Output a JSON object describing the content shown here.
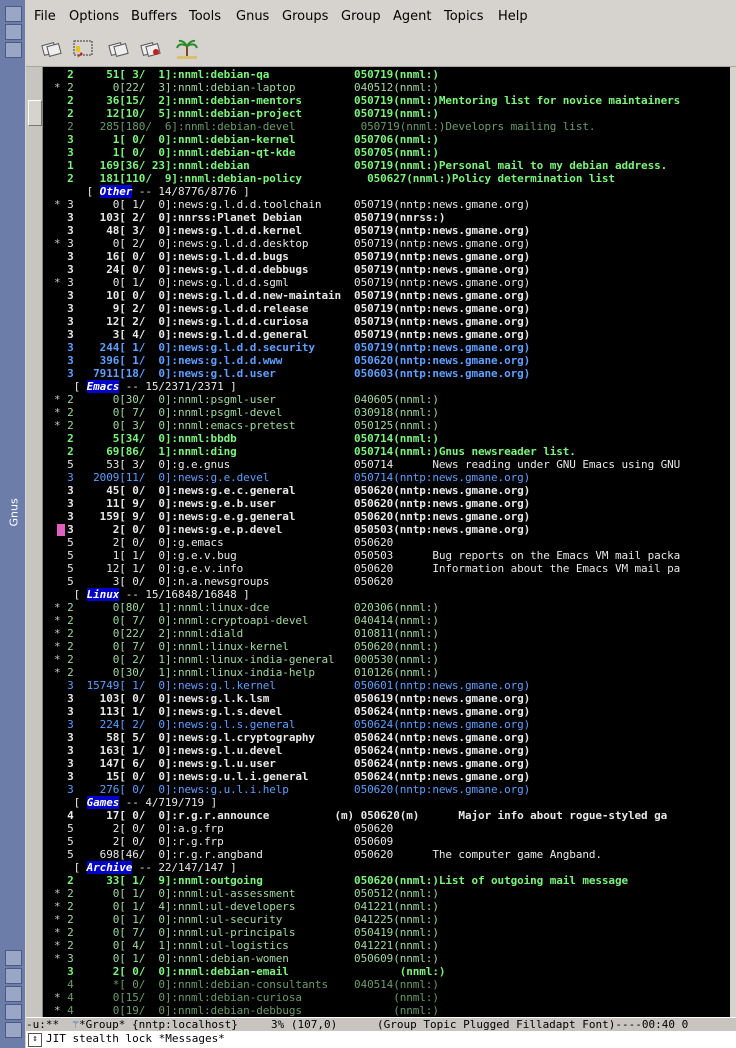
{
  "menu": [
    "File",
    "Options",
    "Buffers",
    "Tools",
    "Gnus",
    "Groups",
    "Group",
    "Agent",
    "Topics",
    "Help"
  ],
  "frame_label": "Gnus",
  "toolbar_icons": [
    "catchup-icon",
    "get-new-news-icon",
    "subscribe-icon",
    "unsubscribe-icon",
    "exit-gnus-icon"
  ],
  "colors": {
    "bg": "#000000",
    "dim": "#a0d8a0",
    "bright": "#90ee90",
    "cyan": "#7fb2ff",
    "white": "#e8e8e8",
    "topic_bg": "#0000c8"
  },
  "lines": [
    {
      "m": " ",
      "t": "2     51[ 3/  1]:nnml:debian-qa             050719(nnml:)",
      "c": "bright",
      "b": true
    },
    {
      "m": "*",
      "t": "2      0[22/  3]:nnml:debian-laptop         040512(nnml:)",
      "c": "dim"
    },
    {
      "m": " ",
      "t": "2     36[15/  2]:nnml:debian-mentors        050719(nnml:)Mentoring list for novice maintainers",
      "c": "bright",
      "b": true
    },
    {
      "m": " ",
      "t": "2     12[10/  5]:nnml:debian-project        050719(nnml:)",
      "c": "bright",
      "b": true
    },
    {
      "m": " ",
      "t": "2    285[180/  6]:nnml:debian-devel          050719(nnml:)Developrs mailing list.",
      "c": "dim2"
    },
    {
      "m": " ",
      "t": "3      1[ 0/  0]:nnml:debian-kernel         050706(nnml:)",
      "c": "bright",
      "b": true
    },
    {
      "m": " ",
      "t": "3      1[ 0/  0]:nnml:debian-qt-kde         050705(nnml:)",
      "c": "bright",
      "b": true
    },
    {
      "m": " ",
      "t": "1    169[36/ 23]:nnml:debian                050719(nnml:)Personal mail to my debian address.",
      "c": "bright",
      "b": true
    },
    {
      "m": " ",
      "t": "2    181[110/  9]:nnml:debian-policy          050627(nnml:)Policy determination list",
      "c": "bright",
      "b": true
    },
    {
      "m": " ",
      "topic": "Other",
      "t": " -- 14/8776/8776 ]",
      "c": "white",
      "indent": "    [ "
    },
    {
      "m": "*",
      "t": "3      0[ 1/  0]:news:g.l.d.d.toolchain     050719(nntp:news.gmane.org)",
      "c": "white"
    },
    {
      "m": " ",
      "t": "3    103[ 2/  0]:nnrss:Planet Debian        050719(nnrss:)",
      "c": "white",
      "b": true
    },
    {
      "m": " ",
      "t": "3     48[ 3/  0]:news:g.l.d.d.kernel        050719(nntp:news.gmane.org)",
      "c": "white",
      "b": true
    },
    {
      "m": "*",
      "t": "3      0[ 2/  0]:news:g.l.d.d.desktop       050719(nntp:news.gmane.org)",
      "c": "white"
    },
    {
      "m": " ",
      "t": "3     16[ 0/  0]:news:g.l.d.d.bugs          050719(nntp:news.gmane.org)",
      "c": "white",
      "b": true
    },
    {
      "m": " ",
      "t": "3     24[ 0/  0]:news:g.l.d.d.debbugs       050719(nntp:news.gmane.org)",
      "c": "white",
      "b": true
    },
    {
      "m": "*",
      "t": "3      0[ 1/  0]:news:g.l.d.d.sgml          050719(nntp:news.gmane.org)",
      "c": "white"
    },
    {
      "m": " ",
      "t": "3     10[ 0/  0]:news:g.l.d.d.new-maintain  050719(nntp:news.gmane.org)",
      "c": "white",
      "b": true
    },
    {
      "m": " ",
      "t": "3      9[ 2/  0]:news:g.l.d.d.release       050719(nntp:news.gmane.org)",
      "c": "white",
      "b": true
    },
    {
      "m": " ",
      "t": "3     12[ 2/  0]:news:g.l.d.d.curiosa       050719(nntp:news.gmane.org)",
      "c": "white",
      "b": true
    },
    {
      "m": " ",
      "t": "3      3[ 4/  0]:news:g.l.d.d.general       050719(nntp:news.gmane.org)",
      "c": "white",
      "b": true
    },
    {
      "m": " ",
      "t": "3    244[ 1/  0]:news:g.l.d.d.security      050719(nntp:news.gmane.org)",
      "c": "cyan",
      "b": true
    },
    {
      "m": " ",
      "t": "3    396[ 1/  0]:news:g.l.d.d.www           050620(nntp:news.gmane.org)",
      "c": "cyan",
      "b": true
    },
    {
      "m": " ",
      "t": "3   7911[18/  0]:news:g.l.d.user            050603(nntp:news.gmane.org)",
      "c": "cyan",
      "b": true
    },
    {
      "m": " ",
      "topic": "Emacs",
      "t": " -- 15/2371/2371 ]",
      "c": "white",
      "indent": "  [ "
    },
    {
      "m": "*",
      "t": "2      0[30/  0]:nnml:psgml-user            040605(nnml:)",
      "c": "dim"
    },
    {
      "m": "*",
      "t": "2      0[ 7/  0]:nnml:psgml-devel           030918(nnml:)",
      "c": "dim"
    },
    {
      "m": "*",
      "t": "2      0[ 3/  0]:nnml:emacs-pretest         050125(nnml:)",
      "c": "dim"
    },
    {
      "m": " ",
      "t": "2      5[34/  0]:nnml:bbdb                  050714(nnml:)",
      "c": "bright",
      "b": true
    },
    {
      "m": " ",
      "t": "2     69[86/  1]:nnml:ding                  050714(nnml:)Gnus newsreader list.",
      "c": "bright",
      "b": true
    },
    {
      "m": " ",
      "t": "5     53[ 3/  0]:g.e.gnus                   050714      News reading under GNU Emacs using GNU",
      "c": "white"
    },
    {
      "m": " ",
      "t": "3   2009[11/  0]:news:g.e.devel             050714(nntp:news.gmane.org)",
      "c": "cyan"
    },
    {
      "m": " ",
      "t": "3     45[ 0/  0]:news:g.e.c.general         050620(nntp:news.gmane.org)",
      "c": "white",
      "b": true
    },
    {
      "m": " ",
      "t": "3     11[ 9/  0]:news:g.e.b.user            050620(nntp:news.gmane.org)",
      "c": "white",
      "b": true
    },
    {
      "m": " ",
      "t": "3    159[ 9/  0]:news:g.e.g.general         050620(nntp:news.gmane.org)",
      "c": "white",
      "b": true
    },
    {
      "m": " ",
      "t": "3      2[ 0/  0]:news:g.e.p.devel           050503(nntp:news.gmane.org)",
      "c": "white",
      "b": true
    },
    {
      "m": " ",
      "t": "5      2[ 0/  0]:g.emacs                    050620",
      "c": "white"
    },
    {
      "m": " ",
      "t": "5      1[ 1/  0]:g.e.v.bug                  050503      Bug reports on the Emacs VM mail packa",
      "c": "white"
    },
    {
      "m": " ",
      "t": "5     12[ 1/  0]:g.e.v.info                 050620      Information about the Emacs VM mail pa",
      "c": "white"
    },
    {
      "m": " ",
      "t": "5      3[ 0/  0]:n.a.newsgroups             050620",
      "c": "white"
    },
    {
      "m": " ",
      "topic": "Linux",
      "t": " -- 15/16848/16848 ]",
      "c": "white",
      "indent": "  [ "
    },
    {
      "m": "*",
      "t": "2      0[80/  1]:nnml:linux-dce             020306(nnml:)",
      "c": "dim"
    },
    {
      "m": "*",
      "t": "2      0[ 7/  0]:nnml:cryptoapi-devel       040414(nnml:)",
      "c": "dim"
    },
    {
      "m": "*",
      "t": "2      0[22/  2]:nnml:diald                 010811(nnml:)",
      "c": "dim"
    },
    {
      "m": "*",
      "t": "2      0[ 7/  0]:nnml:linux-kernel          050620(nnml:)",
      "c": "dim"
    },
    {
      "m": "*",
      "t": "2      0[ 2/  1]:nnml:linux-india-general   000530(nnml:)",
      "c": "dim"
    },
    {
      "m": "*",
      "t": "2      0[30/  1]:nnml:linux-india-help      010126(nnml:)",
      "c": "dim"
    },
    {
      "m": " ",
      "t": "3  15749[ 1/  0]:news:g.l.kernel            050601(nntp:news.gmane.org)",
      "c": "cyan"
    },
    {
      "m": " ",
      "t": "3    103[ 0/  0]:news:g.l.k.lsm             050619(nntp:news.gmane.org)",
      "c": "white",
      "b": true
    },
    {
      "m": " ",
      "t": "3    113[ 1/  0]:news:g.l.s.devel           050624(nntp:news.gmane.org)",
      "c": "white",
      "b": true
    },
    {
      "m": " ",
      "t": "3    224[ 2/  0]:news:g.l.s.general         050624(nntp:news.gmane.org)",
      "c": "cyan"
    },
    {
      "m": " ",
      "t": "3     58[ 5/  0]:news:g.l.cryptography      050624(nntp:news.gmane.org)",
      "c": "white",
      "b": true
    },
    {
      "m": " ",
      "t": "3    163[ 1/  0]:news:g.l.u.devel           050624(nntp:news.gmane.org)",
      "c": "white",
      "b": true
    },
    {
      "m": " ",
      "t": "3    147[ 6/  0]:news:g.l.u.user            050624(nntp:news.gmane.org)",
      "c": "white",
      "b": true
    },
    {
      "m": " ",
      "t": "3     15[ 0/  0]:news:g.u.l.i.general       050624(nntp:news.gmane.org)",
      "c": "white",
      "b": true
    },
    {
      "m": " ",
      "t": "3    276[ 0/  0]:news:g.u.l.i.help          050620(nntp:news.gmane.org)",
      "c": "cyan"
    },
    {
      "m": " ",
      "topic": "Games",
      "t": " -- 4/719/719 ]",
      "c": "white",
      "indent": "  [ "
    },
    {
      "m": " ",
      "t": "4     17[ 0/  0]:r.g.r.announce          (m) 050620(m)      Major info about rogue-styled ga",
      "c": "white",
      "b": true
    },
    {
      "m": " ",
      "t": "5      2[ 0/  0]:a.g.frp                    050620",
      "c": "white"
    },
    {
      "m": " ",
      "t": "5      2[ 0/  0]:r.g.frp                    050609",
      "c": "white"
    },
    {
      "m": " ",
      "t": "5    698[46/  0]:r.g.r.angband              050620      The computer game Angband.",
      "c": "white"
    },
    {
      "m": " ",
      "topic": "Archive",
      "t": " -- 22/147/147 ]",
      "c": "white",
      "indent": "  [ "
    },
    {
      "m": " ",
      "t": "2     33[ 1/  9]:nnml:outgoing              050620(nnml:)List of outgoing mail message",
      "c": "bright",
      "b": true
    },
    {
      "m": "*",
      "t": "2      0[ 1/  0]:nnml:ul-assessment         050512(nnml:)",
      "c": "dim"
    },
    {
      "m": "*",
      "t": "2      0[ 1/  4]:nnml:ul-developers         041221(nnml:)",
      "c": "dim"
    },
    {
      "m": "*",
      "t": "2      0[ 1/  0]:nnml:ul-security           041225(nnml:)",
      "c": "dim"
    },
    {
      "m": "*",
      "t": "2      0[ 7/  0]:nnml:ul-principals         050419(nnml:)",
      "c": "dim"
    },
    {
      "m": "*",
      "t": "2      0[ 4/  1]:nnml:ul-logistics          041221(nnml:)",
      "c": "dim"
    },
    {
      "m": "*",
      "t": "3      0[ 1/  0]:nnml:debian-women          050609(nnml:)",
      "c": "dim"
    },
    {
      "m": " ",
      "t": "3      2[ 0/  0]:nnml:debian-email                 (nnml:)",
      "c": "bright",
      "b": true
    },
    {
      "m": " ",
      "t": "4      *[ 0/  0]:nnml:debian-consultants    040514(nnml:)",
      "c": "dim2"
    },
    {
      "m": "*",
      "t": "4      0[15/  0]:nnml:debian-curiosa              (nnml:)",
      "c": "dim2"
    },
    {
      "m": "*",
      "t": "4      0[19/  0]:nnml:debian-debbugs              (nnml:)",
      "c": "dim2"
    }
  ],
  "modeline": "-u:**  ",
  "modeline_rest": "*Group* {nntp:localhost}     3% (107,0)      (Group Topic Plugged Filladapt Font)----00:40 0",
  "minibuffer": "JIT stealth lock *Messages*"
}
